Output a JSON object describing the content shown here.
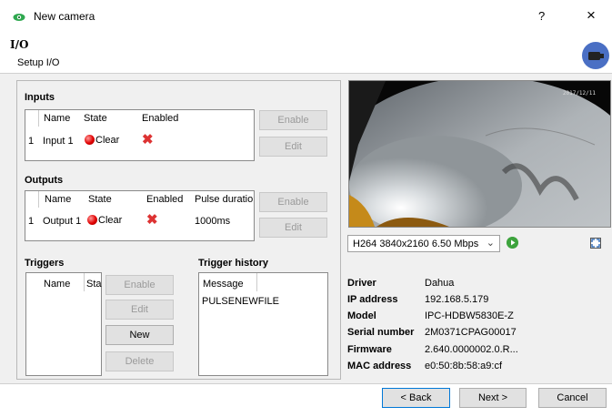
{
  "window": {
    "title": "New camera",
    "help": "?",
    "close": "×"
  },
  "header": {
    "title": "I/O",
    "subtitle": "Setup I/O"
  },
  "inputs": {
    "label": "Inputs",
    "columns": [
      "Name",
      "State",
      "Enabled"
    ],
    "row": {
      "index": "1",
      "name": "Input 1",
      "state": "Clear"
    },
    "enable_label": "Enable",
    "edit_label": "Edit"
  },
  "outputs": {
    "label": "Outputs",
    "columns": [
      "Name",
      "State",
      "Enabled",
      "Pulse duratio"
    ],
    "row": {
      "index": "1",
      "name": "Output 1",
      "state": "Clear",
      "pulse": "1000ms"
    },
    "enable_label": "Enable",
    "edit_label": "Edit"
  },
  "triggers": {
    "label": "Triggers",
    "columns": [
      "Name",
      "Sta"
    ],
    "enable_label": "Enable",
    "edit_label": "Edit",
    "new_label": "New",
    "delete_label": "Delete"
  },
  "trigger_history": {
    "label": "Trigger history",
    "column": "Message",
    "entries": [
      "PULSENEWFILE"
    ]
  },
  "video": {
    "overlay": "2017/12/11",
    "stream": "H264 3840x2160 6.50 Mbps"
  },
  "info": {
    "driver_label": "Driver",
    "driver": "Dahua",
    "ip_label": "IP address",
    "ip": "192.168.5.179",
    "model_label": "Model",
    "model": "IPC-HDBW5830E-Z",
    "serial_label": "Serial number",
    "serial": "2M0371CPAG00017",
    "firmware_label": "Firmware",
    "firmware": "2.640.0000002.0.R...",
    "mac_label": "MAC address",
    "mac": "e0:50:8b:58:a9:cf"
  },
  "footer": {
    "back": "< Back",
    "next": "Next >",
    "cancel": "Cancel"
  },
  "colors": {
    "accent": "#4a6fc4",
    "play": "#3da33d",
    "state_red": "#e00000"
  },
  "icons": [
    "eye-icon",
    "camera-icon",
    "play-icon",
    "fullscreen-icon",
    "red-x-icon",
    "chevron-down-icon"
  ]
}
